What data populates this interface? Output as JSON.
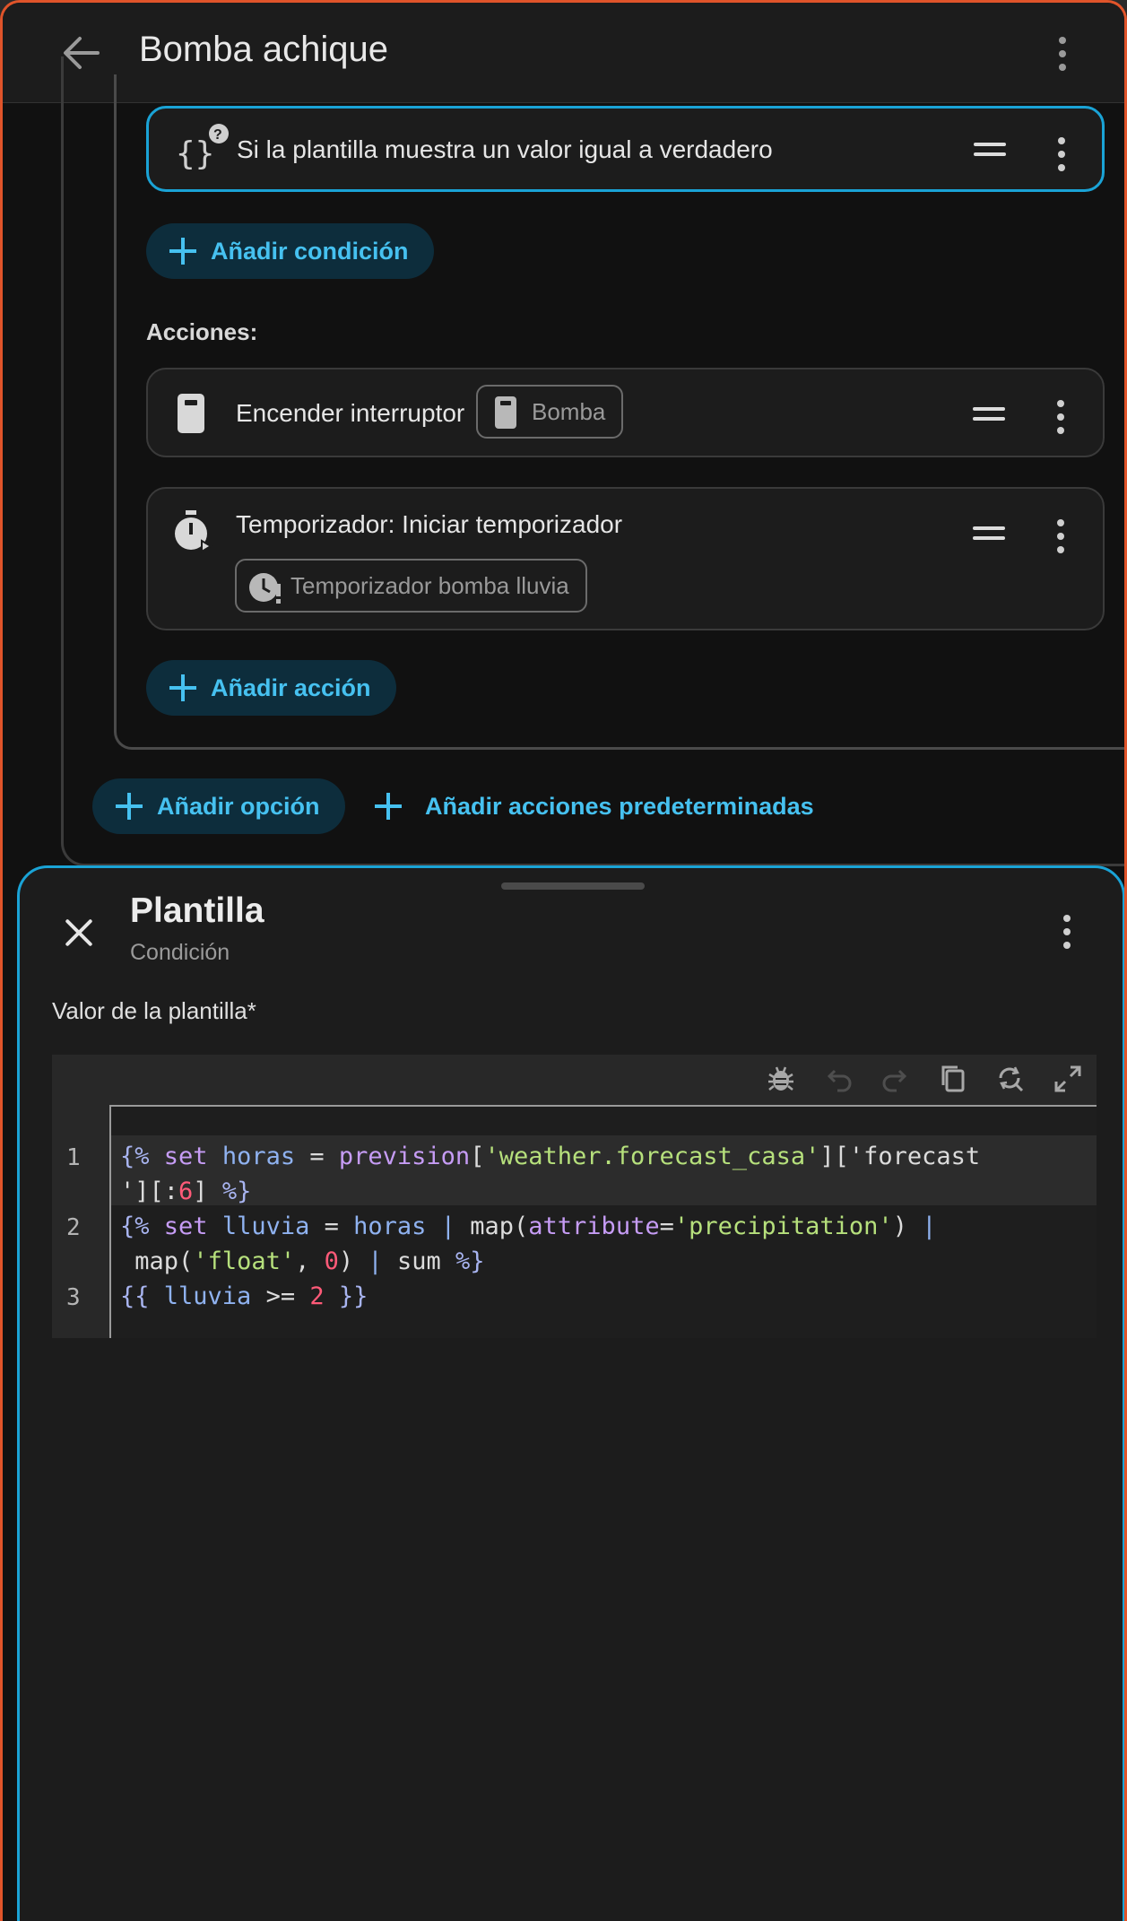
{
  "header": {
    "title": "Bomba achique"
  },
  "condition_card": {
    "label": "Si la plantilla muestra un valor igual a verdadero"
  },
  "buttons": {
    "add_condition": "Añadir condición",
    "add_action": "Añadir acción",
    "add_option": "Añadir opción",
    "add_default_actions": "Añadir acciones predeterminadas"
  },
  "actions_section": {
    "label": "Acciones:",
    "items": [
      {
        "label": "Encender interruptor",
        "chip": "Bomba",
        "icon": "switch-icon"
      },
      {
        "label": "Temporizador: Iniciar temporizador",
        "chip": "Temporizador bomba lluvia",
        "icon": "timer-icon"
      }
    ]
  },
  "sheet": {
    "title": "Plantilla",
    "subtitle": "Condición",
    "field_label": "Valor de la plantilla*",
    "line_numbers": [
      "1",
      "2",
      "3"
    ],
    "code_lines": [
      "{% set horas = prevision['weather.forecast_casa']['forecast'][:6] %}",
      "{% set lluvia = horas | map(attribute='precipitation') | map('float', 0) | sum %}",
      "{{ lluvia >= 2 }}"
    ]
  },
  "colors": {
    "accent": "#46c1f0",
    "selected_border": "#1aa3d6",
    "window_border": "#e0542a"
  }
}
